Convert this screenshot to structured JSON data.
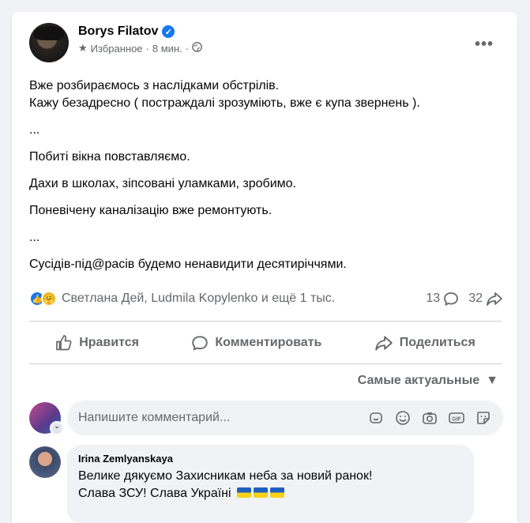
{
  "post": {
    "author": "Borys Filatov",
    "verified_glyph": "✓",
    "audience": "Избранное",
    "time": "8 мин.",
    "dot": "·",
    "more": "•••",
    "lines": [
      "Вже розбираємось з наслідками обстрілів.",
      "Кажу безадресно ( постраждалі зрозуміють, вже є купа звернень  ).",
      "...",
      "Побиті вікна повставляємо.",
      "Дахи в школах, зіпсовані уламками, зробимо.",
      "Поневічену каналізацію вже ремонтують.",
      "...",
      "Сусідів-під@расів будемо ненавидити десятиріччями."
    ]
  },
  "reactions": {
    "names": "Светлана Дей, Ludmila Kopylenko и ещё 1 тыс.",
    "comments": "13",
    "shares": "32"
  },
  "actions": {
    "like": "Нравится",
    "comment": "Комментировать",
    "share": "Поделиться"
  },
  "comments_section": {
    "sort_label": "Самые актуальные",
    "input_placeholder": "Напишите комментарий...",
    "items": [
      {
        "author": "Irina Zemlyanskaya",
        "line1": "Велике дякуємо Захисникам неба за новий ранок!",
        "line2": "Слава ЗСУ! Слава Україні"
      }
    ]
  },
  "colors": {
    "accent": "#1877f2",
    "secondary_text": "#65676b",
    "background": "#f0f2f5"
  },
  "icons": [
    "star-icon",
    "globe-icon",
    "like-icon",
    "comment-icon",
    "share-icon",
    "sticker-icon",
    "emoji-icon",
    "camera-icon",
    "gif-icon",
    "avatar-sticker-icon"
  ]
}
